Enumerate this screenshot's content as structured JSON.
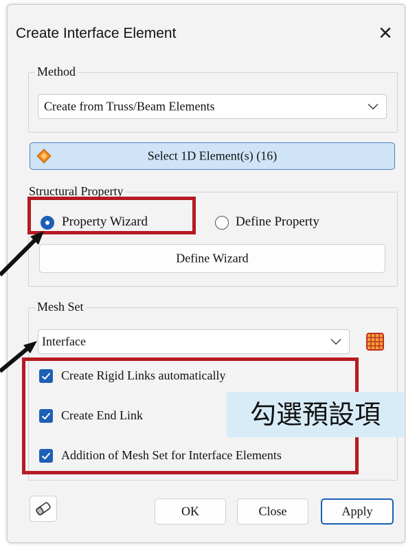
{
  "dialog": {
    "title": "Create Interface Element",
    "close_glyph": "✕"
  },
  "method": {
    "legend": "Method",
    "selected": "Create from Truss/Beam Elements"
  },
  "select_button": {
    "label": "Select 1D Element(s) (16)",
    "icon": "diamond-icon",
    "accent_color": "#f08a1c"
  },
  "structural_property": {
    "legend": "Structural Property",
    "options": [
      {
        "label": "Property Wizard",
        "selected": true
      },
      {
        "label": "Define Property",
        "selected": false
      }
    ],
    "wizard_button": "Define Wizard"
  },
  "mesh_set": {
    "legend": "Mesh Set",
    "selected": "Interface",
    "icon": "mesh-grid-icon"
  },
  "checkboxes": [
    {
      "label": "Create Rigid Links automatically",
      "checked": true
    },
    {
      "label": "Create End Link",
      "checked": true
    },
    {
      "label": "Addition of Mesh Set for Interface Elements",
      "checked": true
    }
  ],
  "footer": {
    "eraser_icon": "eraser-icon",
    "ok": "OK",
    "close": "Close",
    "apply": "Apply"
  },
  "annotation": {
    "text": "勾選預設項",
    "highlight_color": "#b61a22"
  }
}
